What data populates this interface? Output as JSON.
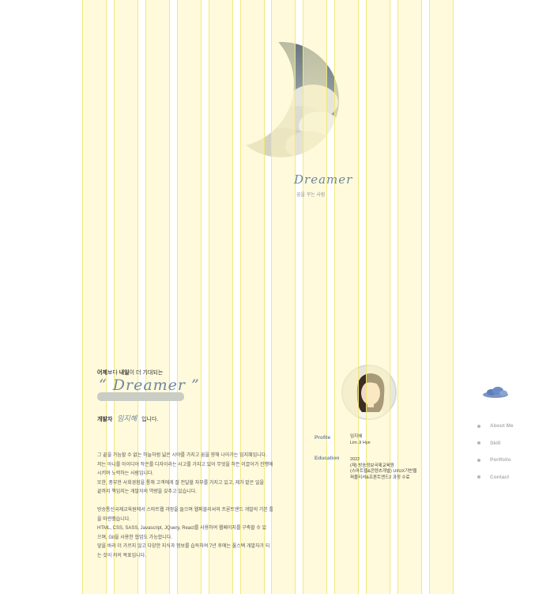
{
  "hero": {
    "logo_text": "Dreamer",
    "subtitle": "꿈을 꾸는 사람"
  },
  "intro": {
    "kicker_bold": "어제",
    "kicker_mid": "보다 ",
    "kicker_bold2": "내일",
    "kicker_rest": "이 더 기대되는",
    "quote": "“ Dreamer ”",
    "dev_label": "개발자",
    "dev_name": "임지혜",
    "dev_suffix": "입니다."
  },
  "paragraph1": [
    "그 끝을 가늠할 수 없는 하늘처럼 넓은 시야를 가지고 꿈을 향해 나아가는 임지혜입니다.",
    "저는 아니를 아이디어 작은를 디자이라는 사고를 가지고 있어 무엇을 하든 이끌어가 진행에",
    "시키며 노력하는 사람입니다.",
    "또한, 풍부한 사회경험을 통해 고객에게 잘 전달할 자부를 가지고 있고, 제가 맡은 일을",
    "끝까지 책임지는 개발자의 역량을 갖추고 있습니다."
  ],
  "paragraph2": [
    "방송통신국제교육원에서 스마트웹 과정을 들으며 웹퍼블리셔와 프론트엔드 개발의 기본 틀",
    "을 마련했습니다.",
    "HTML, CSS, SASS, Javascript, JQuery, React를 사용하여 웹페이지를 구축할 수 있",
    "으며, Git을 사용한 협업도 가능합니다.",
    "앞을 바라 더 가르지 않고 다양한 지식과 정보를 습득하여 7년 후에는 풀스택 개발자가 되",
    "는 것이 저의 목표입니다."
  ],
  "profile": {
    "label": "Profile",
    "name_ko": "임지혜",
    "name_en": "Lim Ji Hye"
  },
  "education": {
    "label": "Education",
    "year": "2022",
    "lines": [
      "(재) 방송정보국제교육원",
      "(스마트웹&콘텐츠개발) UI/UX기반웹",
      "퍼블리셔&프론트엔드2 과정 수료"
    ]
  },
  "nav": {
    "items": [
      "About Me",
      "Skill",
      "Portfolio",
      "Contact"
    ]
  },
  "colors": {
    "accent": "#6f86a0",
    "grid": "#fff6be"
  }
}
